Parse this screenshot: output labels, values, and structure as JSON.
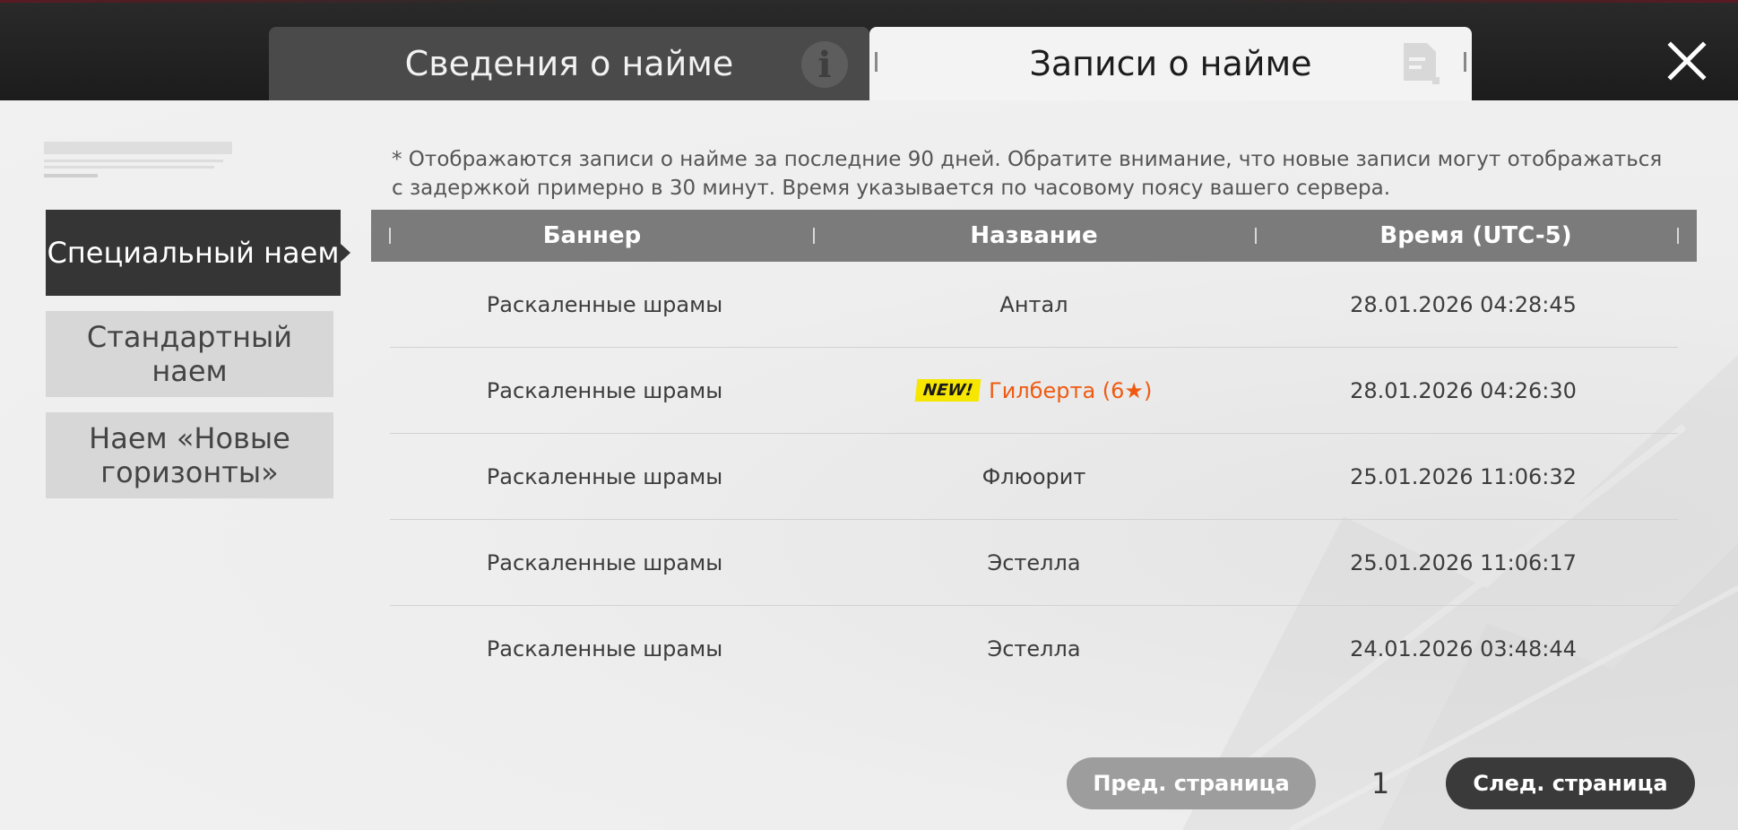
{
  "tabs": [
    {
      "label": "Сведения о найме",
      "icon": "info-icon",
      "active": false
    },
    {
      "label": "Записи о найме",
      "icon": "document-icon",
      "active": true
    }
  ],
  "close_icon": "close-icon",
  "sidebar": {
    "items": [
      {
        "label": "Специальный наем",
        "active": true
      },
      {
        "label": "Стандартный наем",
        "active": false
      },
      {
        "label": "Наем «Новые горизонты»",
        "active": false
      }
    ]
  },
  "notice": "* Отображаются записи о найме за последние 90 дней. Обратите внимание, что новые записи могут отображаться с задержкой примерно в 30 минут. Время указывается по часовому поясу вашего сервера.",
  "table": {
    "headers": [
      "Баннер",
      "Название",
      "Время (UTC-5)"
    ],
    "rows": [
      {
        "banner": "Раскаленные шрамы",
        "name": "Антал",
        "time": "28.01.2026 04:28:45",
        "is_new": false
      },
      {
        "banner": "Раскаленные шрамы",
        "name": "Гилберта (6★)",
        "time": "28.01.2026 04:26:30",
        "is_new": true
      },
      {
        "banner": "Раскаленные шрамы",
        "name": "Флюорит",
        "time": "25.01.2026 11:06:32",
        "is_new": false
      },
      {
        "banner": "Раскаленные шрамы",
        "name": "Эстелла",
        "time": "25.01.2026 11:06:17",
        "is_new": false
      },
      {
        "banner": "Раскаленные шрамы",
        "name": "Эстелла",
        "time": "24.01.2026 03:48:44",
        "is_new": false
      }
    ],
    "new_badge": "NEW!"
  },
  "pager": {
    "prev_label": "Пред. страница",
    "page": "1",
    "next_label": "След. страница"
  },
  "colors": {
    "accent_new": "#f6e600",
    "highlight_name": "#ef5a12",
    "active_tab": "#f3f3f3",
    "sidebar_active": "#353535"
  }
}
